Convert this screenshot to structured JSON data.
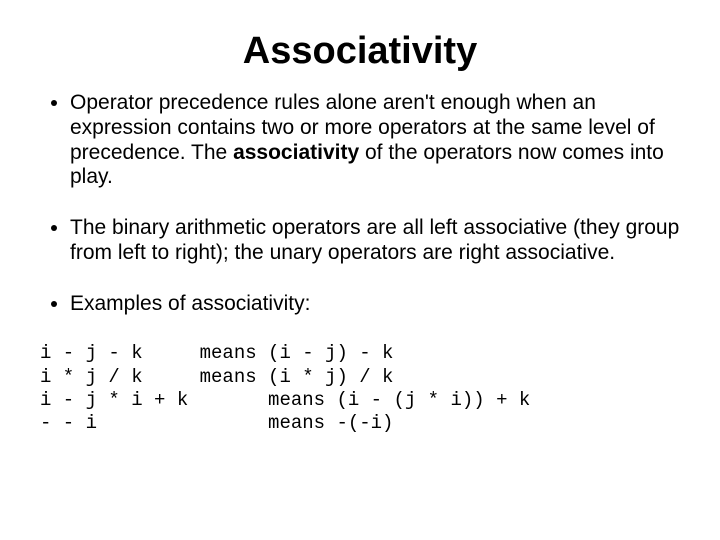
{
  "title": "Associativity",
  "bullets": {
    "b1_before": "Operator precedence rules alone aren't enough when an expression contains two or more operators at the same level of precedence. The ",
    "b1_word": "associativity",
    "b1_after": " of the operators now comes into play.",
    "b2": "The binary arithmetic operators are all left associative (they group from left to right); the unary operators are right associative.",
    "b3": "Examples of associativity:"
  },
  "examples": "i - j - k     means (i - j) - k\ni * j / k     means (i * j) / k\ni - j * i + k       means (i - (j * i)) + k\n- - i               means -(-i)"
}
